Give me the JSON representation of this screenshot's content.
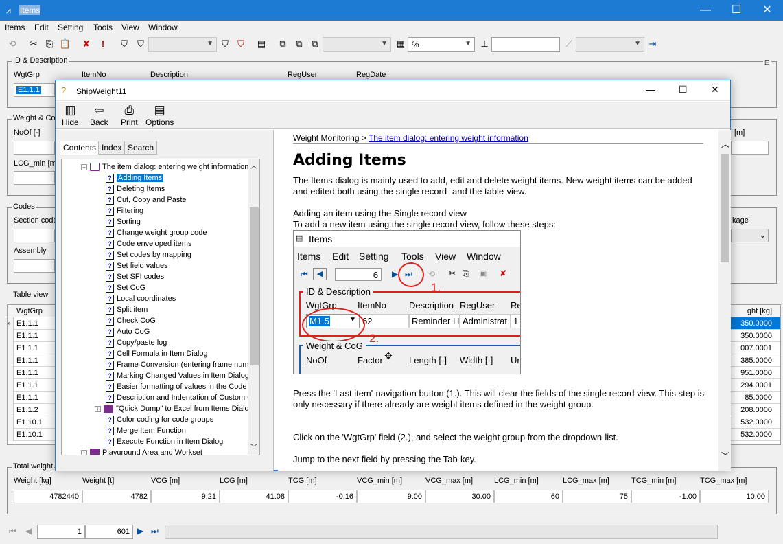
{
  "app": {
    "title": "Items",
    "menu": [
      "Items",
      "Edit",
      "Setting",
      "Tools",
      "View",
      "Window"
    ],
    "toolbar": {
      "percent_value": "%"
    }
  },
  "id_desc": {
    "label": "ID & Description",
    "cols": [
      "WgtGrp",
      "ItemNo",
      "Description",
      "RegUser",
      "RegDate"
    ],
    "wgtgrp_value": "E1.1.1"
  },
  "weight_cog": {
    "label": "Weight & Co",
    "noof": "NoOf [-]",
    "lcg_min": "LCG_min [m]",
    "right_unit": "[m]"
  },
  "codes": {
    "label": "Codes",
    "section": "Section code",
    "assembly": "Assembly",
    "package": "kage"
  },
  "table_view": {
    "label": "Table view",
    "col1": "WgtGrp",
    "col_right": "ght [kg]",
    "rows": [
      {
        "grp": "E1.1.1",
        "val": "350.0000",
        "selected": true
      },
      {
        "grp": "E1.1.1",
        "val": "350.0000"
      },
      {
        "grp": "E1.1.1",
        "val": "007.0001"
      },
      {
        "grp": "E1.1.1",
        "val": "385.0000"
      },
      {
        "grp": "E1.1.1",
        "val": "951.0000"
      },
      {
        "grp": "E1.1.1",
        "val": "294.0001"
      },
      {
        "grp": "E1.1.1",
        "val": "85.0000"
      },
      {
        "grp": "E1.1.2",
        "val": "208.0000"
      },
      {
        "grp": "E1.10.1",
        "val": "532.0000"
      },
      {
        "grp": "E1.10.1",
        "val": "532.0000"
      }
    ]
  },
  "total": {
    "label": "Total weight",
    "headers": [
      "Weight [kg]",
      "Weight [t]",
      "VCG [m]",
      "LCG [m]",
      "TCG [m]",
      "VCG_min [m]",
      "VCG_max [m]",
      "LCG_min [m]",
      "LCG_max [m]",
      "TCG_min [m]",
      "TCG_max [m]"
    ],
    "values": [
      "4782440",
      "4782",
      "9.21",
      "41.08",
      "-0.16",
      "9.00",
      "30.00",
      "60",
      "75",
      "-1.00",
      "10.00"
    ]
  },
  "nav": {
    "current": "1",
    "total": "601"
  },
  "help": {
    "title": "ShipWeight11",
    "buttons": [
      "Hide",
      "Back",
      "Print",
      "Options"
    ],
    "tabs": [
      "Contents",
      "Index",
      "Search"
    ],
    "tree_root": "The item dialog: entering weight information",
    "tree_items": [
      "Adding Items",
      "Deleting Items",
      "Cut, Copy and Paste",
      "Filtering",
      "Sorting",
      "Change weight group code",
      "Code enveloped items",
      "Set codes by mapping",
      "Set field values",
      "Set SFI codes",
      "Set CoG",
      "Local coordinates",
      "Split item",
      "Check CoG",
      "Auto CoG",
      "Copy/paste log",
      "Cell Formula in Item Dialog",
      "Frame Conversion (entering frame numb",
      "Marking Changed Values in Item Dialog",
      "Easier formatting of values in the Code I",
      "Description and Indentation of Custom C"
    ],
    "tree_book": "\"Quick Dump\" to Excel from Items Dialo",
    "tree_after": [
      "Color coding for code groups",
      "Merge Item Function",
      "Execute Function in Item Dialog"
    ],
    "tree_last": "Playground Area and Workset",
    "crumb_root": "Weight Monitoring",
    "crumb_sep": ">",
    "crumb_link": "The item dialog: entering weight information",
    "heading": "Adding Items",
    "p1": "The Items dialog is mainly used to add, edit and delete weight items. New weight items can be added and edited both using the single record- and the table-view.",
    "p2a": "Adding an item using the Single record view",
    "p2b": "To add a new item using the single record view, follow these steps:",
    "p3": "Press the 'Last item'-navigation button (1.). This will clear the fields of the single record view. This step is only necessary if there already are weight items defined in the weight group.",
    "p4": "Click on the 'WgtGrp' field (2.), and select the weight group from the dropdown-list.",
    "p5": "Jump to the next field by pressing the Tab-key."
  },
  "embedded": {
    "title": "Items",
    "menu": [
      "Items",
      "Edit",
      "Setting",
      "Tools",
      "View",
      "Window"
    ],
    "record": "6",
    "marker1": "1.",
    "marker2": "2.",
    "id_label": "ID & Description",
    "cols": [
      "WgtGrp",
      "ItemNo",
      "Description",
      "RegUser",
      "Re"
    ],
    "vals": [
      "M1.5",
      "62",
      "Reminder H",
      "Administrat",
      "1"
    ],
    "wc_label": "Weight & CoG",
    "wc_cols": [
      "NoOf",
      "Factor",
      "Length [-]",
      "Width [-]",
      "Un"
    ]
  }
}
